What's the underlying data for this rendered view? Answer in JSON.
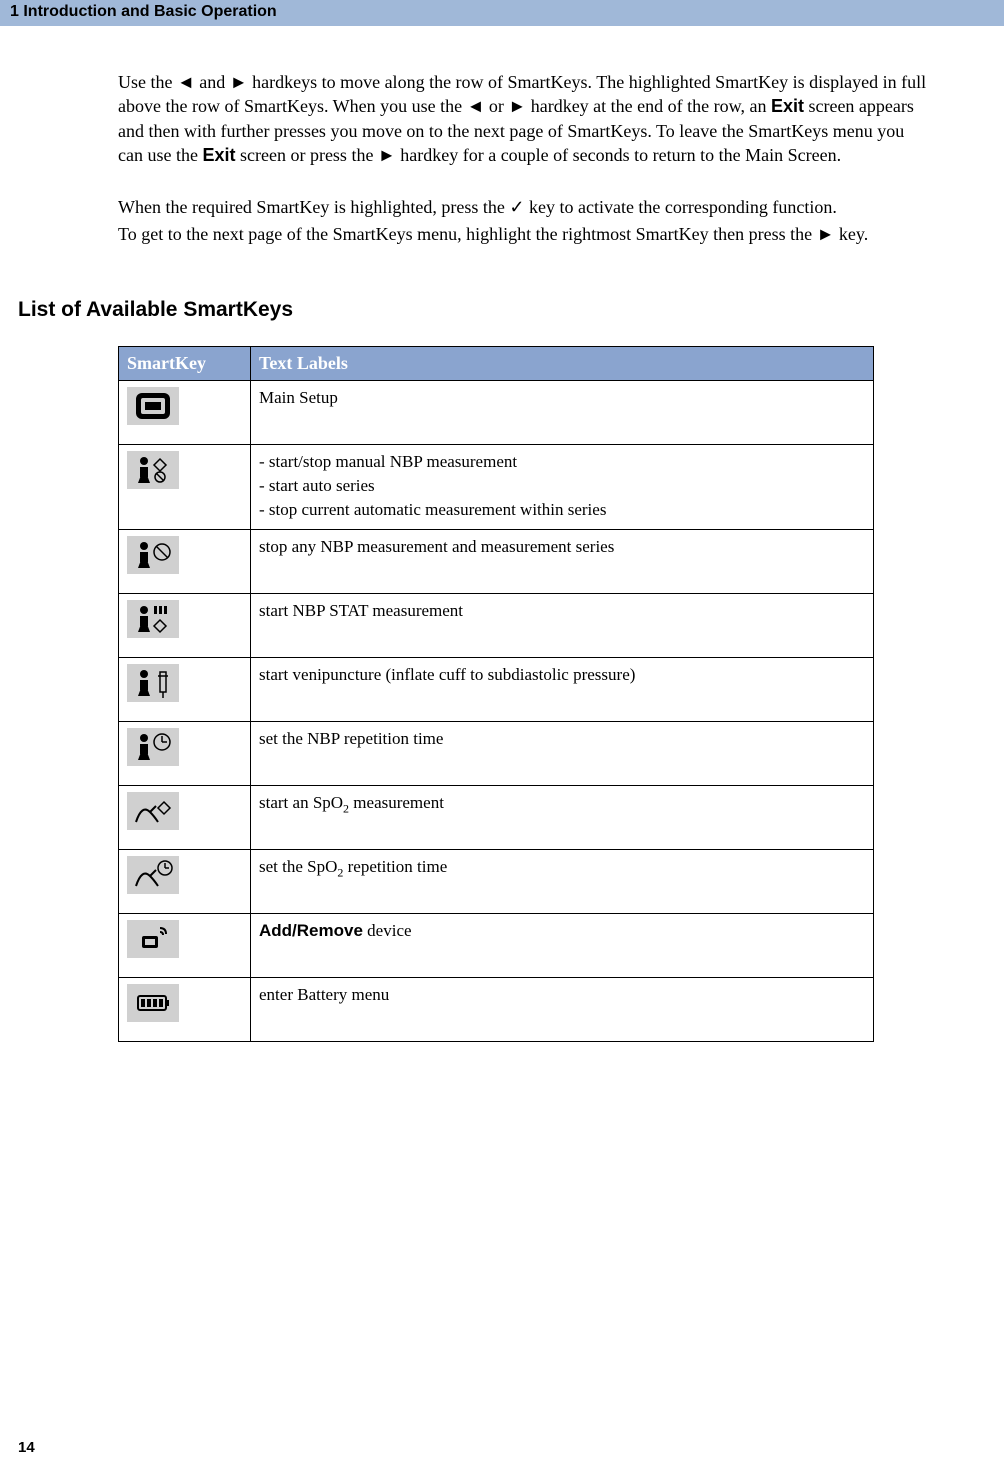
{
  "header": {
    "chapter": "1 Introduction and Basic Operation"
  },
  "paragraphs": {
    "p1_a": "Use the ◄ and ► hardkeys to move along the row of SmartKeys. The highlighted SmartKey is displayed in full above the row of SmartKeys. When you use the ◄ or ► hardkey at the end of the row, an ",
    "p1_exit1": "Exit",
    "p1_b": " screen appears and then with further presses you move on to the next page of SmartKeys. To leave the SmartKeys menu you can use the ",
    "p1_exit2": "Exit",
    "p1_c": " screen or press the ► hardkey for a couple of seconds to return to the Main Screen.",
    "p2": "When the required SmartKey is highlighted, press the ✓ key to activate the corresponding function.",
    "p3": "To get to the next page of the SmartKeys menu, highlight the rightmost SmartKey then press the ► key."
  },
  "section_heading": "List of Available SmartKeys",
  "table": {
    "col1": "SmartKey",
    "col2": "Text Labels",
    "rows": [
      {
        "label": "Main Setup"
      },
      {
        "lines": [
          "- start/stop manual NBP measurement",
          "- start auto series",
          "- stop current automatic measurement within series"
        ]
      },
      {
        "label": "stop any NBP measurement and measurement series"
      },
      {
        "label": "start NBP STAT measurement"
      },
      {
        "label": "start venipuncture (inflate cuff to subdiastolic pressure)"
      },
      {
        "label": "set the NBP repetition time"
      },
      {
        "label_html": "start an SpO<sub>2</sub> measurement",
        "pre": "start an SpO",
        "sub": "2",
        "post": " measurement"
      },
      {
        "label_html": "set the SpO<sub>2</sub> repetition time",
        "pre": "set the SpO",
        "sub": "2",
        "post": " repetition time"
      },
      {
        "bold": "Add/Remove",
        "rest": " device"
      },
      {
        "label": "enter Battery menu"
      }
    ]
  },
  "page_number": "14"
}
